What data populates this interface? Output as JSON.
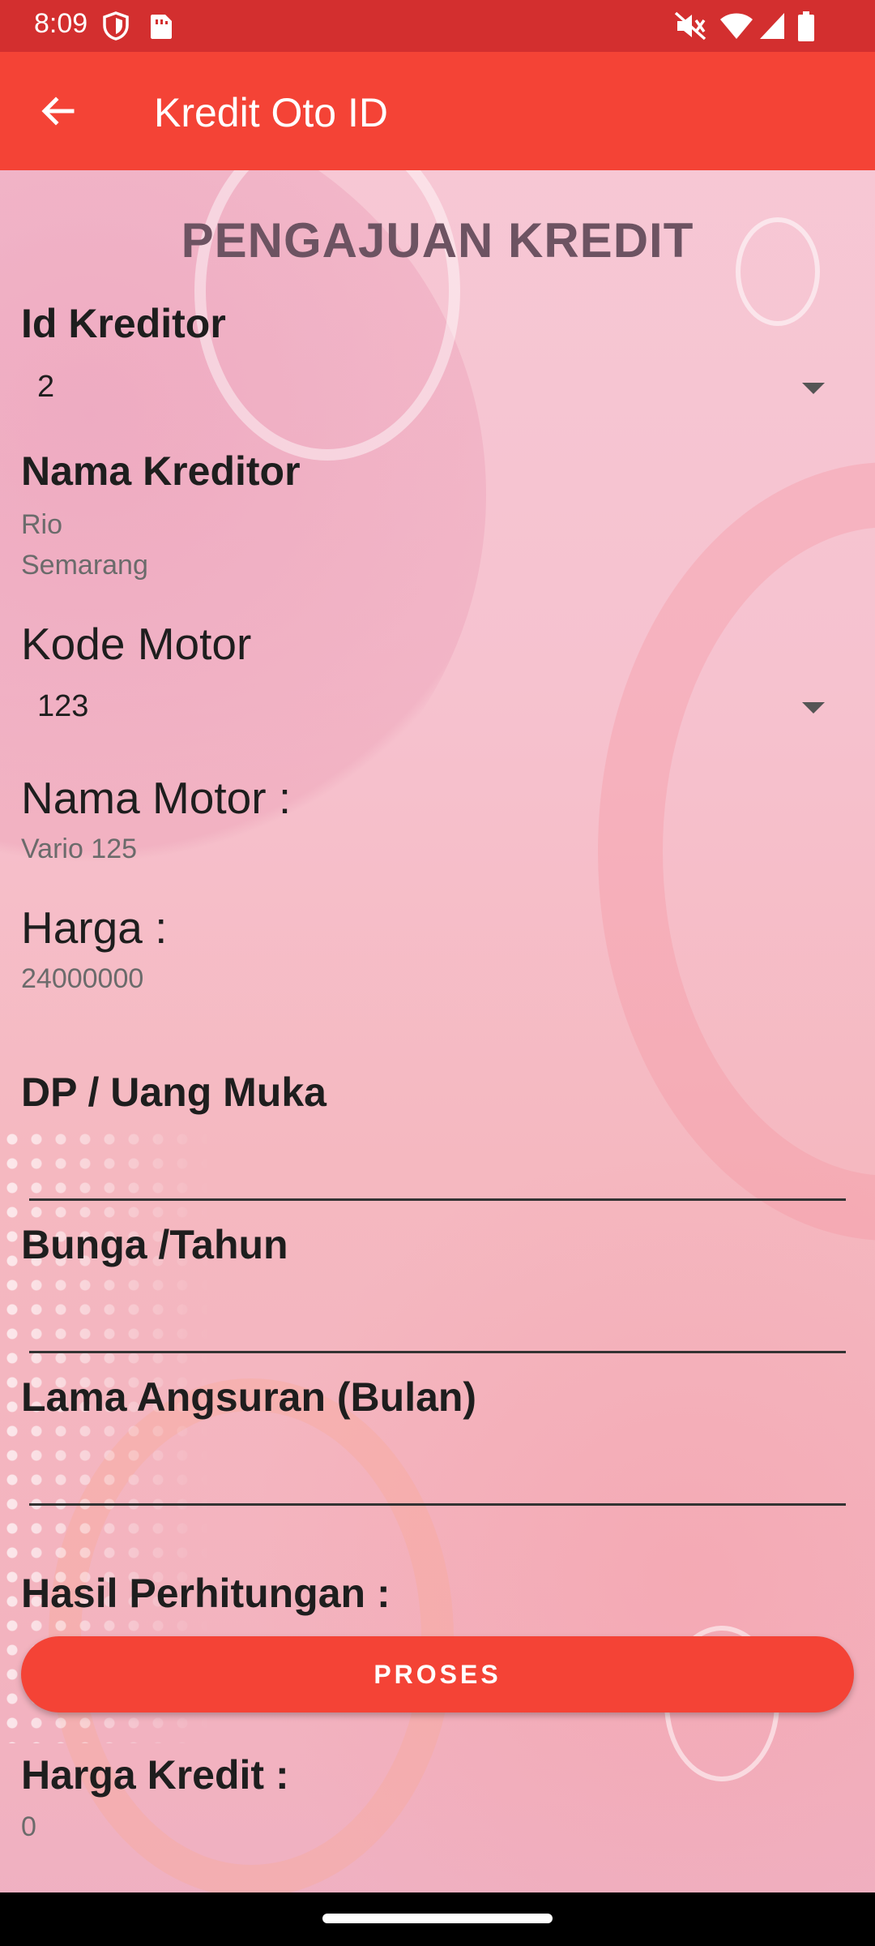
{
  "status_bar": {
    "time": "8:09",
    "icons": [
      "shield-icon",
      "sim-card-icon",
      "mute-icon",
      "wifi-icon",
      "signal-icon",
      "battery-icon"
    ]
  },
  "app_bar": {
    "title": "Kredit Oto ID",
    "back_icon": "arrow-left-icon"
  },
  "colors": {
    "status_bar": "#d32f2f",
    "app_bar": "#f44336",
    "button": "#f44336"
  },
  "form": {
    "heading": "PENGAJUAN KREDIT",
    "id_kreditor": {
      "label": "Id Kreditor",
      "value": "2"
    },
    "nama_kreditor": {
      "label": "Nama Kreditor",
      "name": "Rio",
      "city": "Semarang"
    },
    "kode_motor": {
      "label": "Kode Motor",
      "value": "123"
    },
    "nama_motor": {
      "label": "Nama Motor :",
      "value": "Vario 125"
    },
    "harga": {
      "label": "Harga :",
      "value": "24000000"
    },
    "dp": {
      "label": "DP / Uang Muka",
      "value": ""
    },
    "bunga": {
      "label": "Bunga /Tahun",
      "value": ""
    },
    "lama_angsuran": {
      "label": "Lama Angsuran (Bulan)",
      "value": ""
    },
    "hasil": {
      "label": "Hasil Perhitungan :"
    },
    "proses_button": "PROSES",
    "harga_kredit": {
      "label": "Harga Kredit :",
      "value": "0"
    }
  }
}
